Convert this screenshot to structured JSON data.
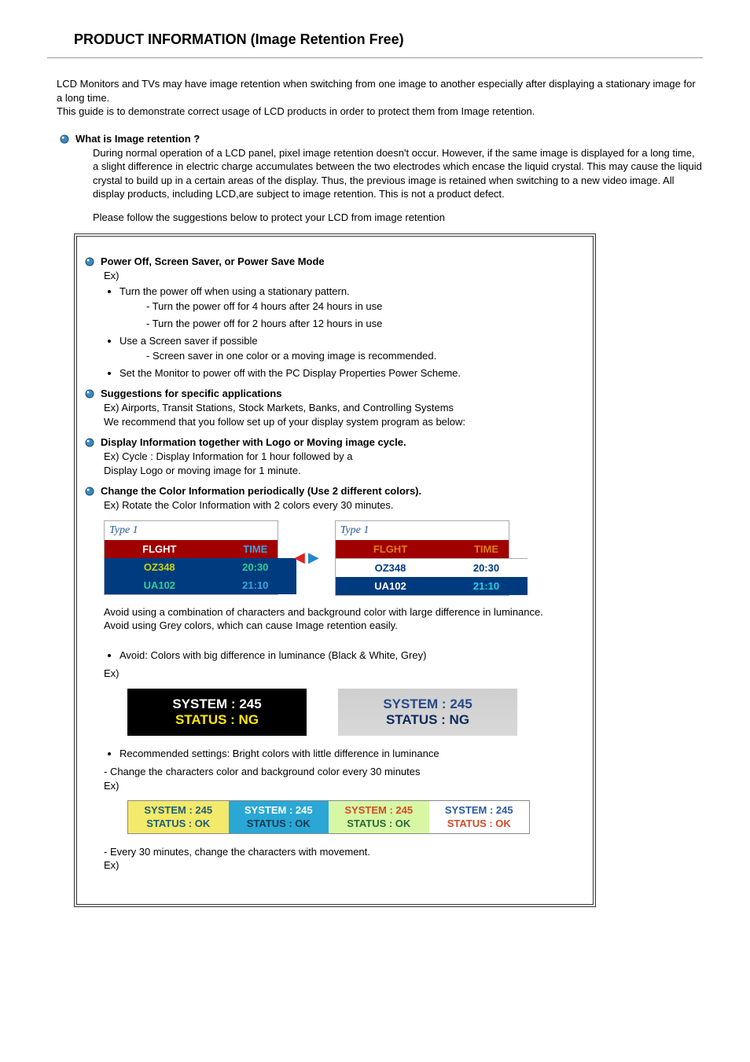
{
  "title": "PRODUCT INFORMATION (Image Retention Free)",
  "intro1": "LCD Monitors and TVs may have image retention when switching from one image to another especially after displaying a stationary image for a long time.",
  "intro2": "This guide is to demonstrate correct usage of LCD products in order to protect them from Image retention.",
  "s1_heading": "What is Image retention ?",
  "s1_body": "During normal operation of a LCD panel, pixel image retention doesn't occur. However, if the same image is displayed for a long time, a slight difference in electric charge accumulates between the two electrodes which encase the liquid crystal. This may cause the liquid crystal to build up in a certain areas of the display. Thus, the previous image is retained when switching to a new video image. All display products, including LCD,are subject to image retention. This is not a product defect.",
  "s1_follow": "Please follow the suggestions below to protect your LCD from image retention",
  "box": {
    "a_heading": "Power Off, Screen Saver, or Power Save Mode",
    "a_ex": "Ex)",
    "a_li1": "Turn the power off when using a stationary pattern.",
    "a_li1a": "- Turn the power off for 4 hours after 24 hours in use",
    "a_li1b": "- Turn the power off for 2 hours after 12 hours in use",
    "a_li2": "Use a Screen saver if possible",
    "a_li2a": "- Screen saver in one color or a moving image is recommended.",
    "a_li3": "Set the Monitor to power off with the PC Display Properties Power Scheme.",
    "b_heading": "Suggestions for specific applications",
    "b_l1": "Ex) Airports, Transit Stations, Stock Markets, Banks, and Controlling Systems",
    "b_l2": "We recommend that you follow set up of your display system program as below:",
    "c_heading": "Display Information together with Logo or Moving image cycle.",
    "c_l1": "Ex) Cycle : Display Information for 1 hour followed by a",
    "c_l2": "Display Logo or moving image for 1 minute.",
    "d_heading": "Change the Color Information periodically (Use 2 different colors).",
    "d_l1": "Ex) Rotate the Color Information with 2 colors every 30 minutes.",
    "flight": {
      "label": "Type 1",
      "hdr1": "FLGHT",
      "hdr2": "TIME",
      "r1c1": "OZ348",
      "r1c2": "20:30",
      "r2c1": "UA102",
      "r2c2": "21:10"
    },
    "d_p1": "Avoid using a combination of characters and background color with large difference in luminance.",
    "d_p2": "Avoid using Grey colors, which can cause Image retention easily.",
    "d_li1": "Avoid: Colors with big difference in luminance (Black & White, Grey)",
    "d_ex": "Ex)",
    "system": {
      "l1": "SYSTEM : 245",
      "l2": "STATUS : NG"
    },
    "e_li1": "Recommended settings: Bright colors with little difference in luminance",
    "e_l1": "- Change the characters color and background color every 30 minutes",
    "e_ex": "Ex)",
    "rec": {
      "l1": "SYSTEM : 245",
      "l2": "STATUS : OK"
    },
    "f_l1": "- Every 30 minutes, change the characters with movement.",
    "f_ex": "Ex)"
  }
}
